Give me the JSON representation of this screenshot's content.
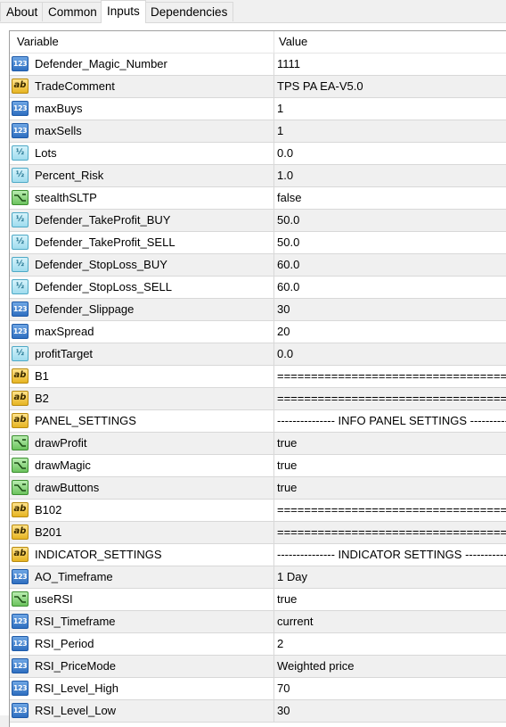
{
  "tabs": [
    "About",
    "Common",
    "Inputs",
    "Dependencies"
  ],
  "active_tab": "Inputs",
  "header": {
    "variable": "Variable",
    "value": "Value"
  },
  "icon_glyphs": {
    "int": "123",
    "str": "ab",
    "dbl": "½",
    "bool": ""
  },
  "rows": [
    {
      "type": "int",
      "name": "Defender_Magic_Number",
      "value": "1111"
    },
    {
      "type": "str",
      "name": "TradeComment",
      "value": "TPS PA EA-V5.0"
    },
    {
      "type": "int",
      "name": "maxBuys",
      "value": "1"
    },
    {
      "type": "int",
      "name": "maxSells",
      "value": "1"
    },
    {
      "type": "dbl",
      "name": "Lots",
      "value": "0.0"
    },
    {
      "type": "dbl",
      "name": "Percent_Risk",
      "value": "1.0"
    },
    {
      "type": "bool",
      "name": "stealthSLTP",
      "value": "false"
    },
    {
      "type": "dbl",
      "name": "Defender_TakeProfit_BUY",
      "value": "50.0"
    },
    {
      "type": "dbl",
      "name": "Defender_TakeProfit_SELL",
      "value": "50.0"
    },
    {
      "type": "dbl",
      "name": "Defender_StopLoss_BUY",
      "value": "60.0"
    },
    {
      "type": "dbl",
      "name": "Defender_StopLoss_SELL",
      "value": "60.0"
    },
    {
      "type": "int",
      "name": "Defender_Slippage",
      "value": "30"
    },
    {
      "type": "int",
      "name": "maxSpread",
      "value": "20"
    },
    {
      "type": "dbl",
      "name": "profitTarget",
      "value": "0.0"
    },
    {
      "type": "str",
      "name": "B1",
      "value": "=============================================="
    },
    {
      "type": "str",
      "name": "B2",
      "value": "=============================================="
    },
    {
      "type": "str",
      "name": "PANEL_SETTINGS",
      "value": "--------------- INFO PANEL SETTINGS ---------------"
    },
    {
      "type": "bool",
      "name": "drawProfit",
      "value": "true"
    },
    {
      "type": "bool",
      "name": "drawMagic",
      "value": "true"
    },
    {
      "type": "bool",
      "name": "drawButtons",
      "value": "true"
    },
    {
      "type": "str",
      "name": "B102",
      "value": "=============================================="
    },
    {
      "type": "str",
      "name": "B201",
      "value": "=============================================="
    },
    {
      "type": "str",
      "name": "INDICATOR_SETTINGS",
      "value": "--------------- INDICATOR SETTINGS ---------------"
    },
    {
      "type": "int",
      "name": "AO_Timeframe",
      "value": "1 Day"
    },
    {
      "type": "bool",
      "name": "useRSI",
      "value": "true"
    },
    {
      "type": "int",
      "name": "RSI_Timeframe",
      "value": "current"
    },
    {
      "type": "int",
      "name": "RSI_Period",
      "value": "2"
    },
    {
      "type": "int",
      "name": "RSI_PriceMode",
      "value": "Weighted price"
    },
    {
      "type": "int",
      "name": "RSI_Level_High",
      "value": "70"
    },
    {
      "type": "int",
      "name": "RSI_Level_Low",
      "value": "30"
    }
  ]
}
